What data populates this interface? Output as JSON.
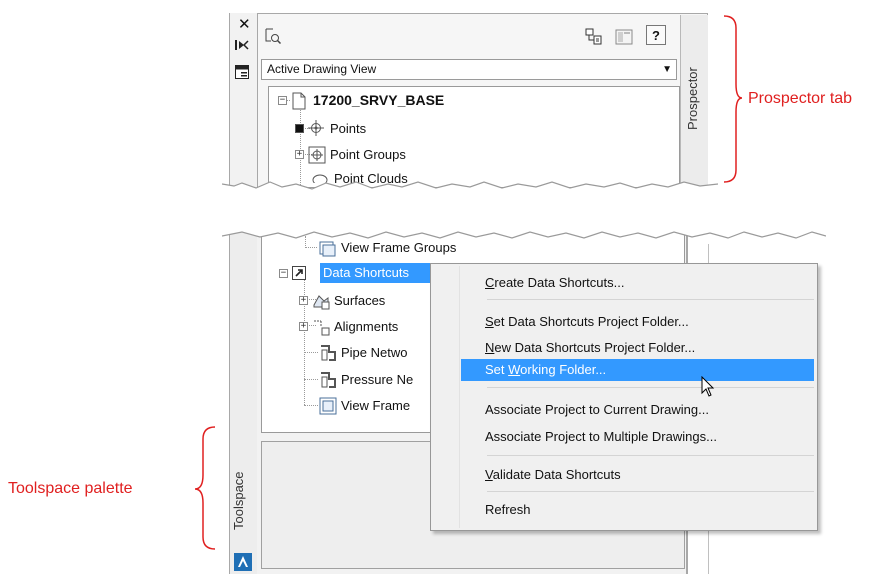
{
  "top_panel": {
    "sidebar_icons": [
      "close-icon",
      "collapse-icon",
      "properties-icon"
    ],
    "toolbar_icons": [
      "zoom-icon",
      "tree-layout-icon",
      "panel-icon",
      "help-icon"
    ],
    "help_label": "?",
    "dropdown_value": "Active Drawing View",
    "vertical_tab": "Prospector",
    "tree": {
      "root": "17200_SRVY_BASE",
      "items": [
        "Points",
        "Point Groups",
        "Point Clouds"
      ]
    }
  },
  "bottom_panel": {
    "tree_items": [
      {
        "label": "View Frame Groups",
        "icon": "view-frame-groups-icon"
      },
      {
        "label": "Data Shortcuts",
        "icon": "shortcut-icon",
        "selected": true
      },
      {
        "label": "Surfaces",
        "icon": "surfaces-icon"
      },
      {
        "label": "Alignments",
        "icon": "alignments-icon"
      },
      {
        "label": "Pipe Netwo",
        "icon": "pipe-network-icon"
      },
      {
        "label": "Pressure Ne",
        "icon": "pressure-network-icon"
      },
      {
        "label": "View Frame",
        "icon": "view-frame-icon"
      }
    ],
    "vertical_tab": "Toolspace"
  },
  "context_menu": {
    "items": [
      {
        "label": "Create Data Shortcuts...",
        "mnemonic": "C"
      },
      {
        "label": "Set Data Shortcuts Project Folder...",
        "mnemonic": "S"
      },
      {
        "label": "New Data Shortcuts Project Folder...",
        "mnemonic": "N"
      },
      {
        "label": "Set Working Folder...",
        "mnemonic": "W",
        "highlighted": true
      },
      {
        "label": "Associate Project to Current Drawing...",
        "mnemonic": ""
      },
      {
        "label": "Associate Project to Multiple Drawings...",
        "mnemonic": ""
      },
      {
        "label": "Validate Data Shortcuts",
        "mnemonic": "V"
      },
      {
        "label": "Refresh",
        "mnemonic": ""
      }
    ]
  },
  "annotations": {
    "prospector_tab": "Prospector tab",
    "toolspace_palette": "Toolspace palette"
  },
  "colors": {
    "selection": "#3399ff",
    "annotation": "#e02020",
    "panel": "#f2f2f2"
  }
}
